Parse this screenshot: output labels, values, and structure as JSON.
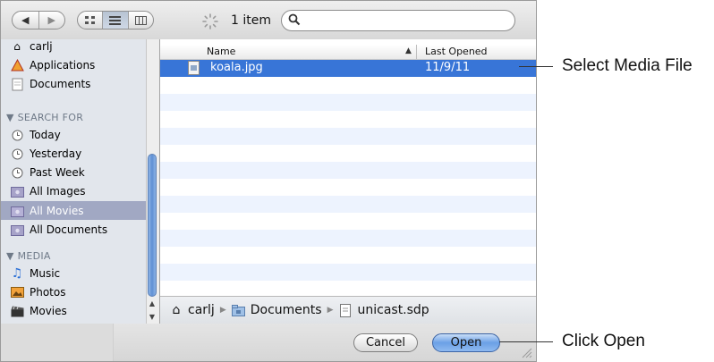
{
  "toolbar": {
    "item_count": "1 item",
    "search": {
      "value": "",
      "placeholder": ""
    }
  },
  "sidebar": {
    "places": [
      {
        "label": "carlj",
        "icon": "home-icon"
      },
      {
        "label": "Applications",
        "icon": "applications-icon"
      },
      {
        "label": "Documents",
        "icon": "documents-folder-icon"
      }
    ],
    "search_for_header": "SEARCH FOR",
    "search_for": [
      {
        "label": "Today",
        "icon": "clock-icon"
      },
      {
        "label": "Yesterday",
        "icon": "clock-icon"
      },
      {
        "label": "Past Week",
        "icon": "clock-icon"
      },
      {
        "label": "All Images",
        "icon": "smart-folder-icon"
      },
      {
        "label": "All Movies",
        "icon": "smart-folder-icon",
        "selected": true
      },
      {
        "label": "All Documents",
        "icon": "smart-folder-icon"
      }
    ],
    "media_header": "MEDIA",
    "media": [
      {
        "label": "Music",
        "icon": "music-icon"
      },
      {
        "label": "Photos",
        "icon": "photos-icon"
      },
      {
        "label": "Movies",
        "icon": "movies-icon"
      }
    ]
  },
  "file_list": {
    "columns": [
      "Name",
      "Last Opened"
    ],
    "rows": [
      {
        "name": "koala.jpg",
        "last_opened": "11/9/11",
        "selected": true
      }
    ]
  },
  "path_bar": [
    "carlj",
    "Documents",
    "unicast.sdp"
  ],
  "buttons": {
    "cancel": "Cancel",
    "open": "Open"
  },
  "callouts": {
    "select_media": "Select Media File",
    "click_open": "Click Open"
  },
  "colors": {
    "selection": "#3875d7",
    "sidebar_selection": "#a1a8c3",
    "open_button": "#6aa0e6"
  }
}
